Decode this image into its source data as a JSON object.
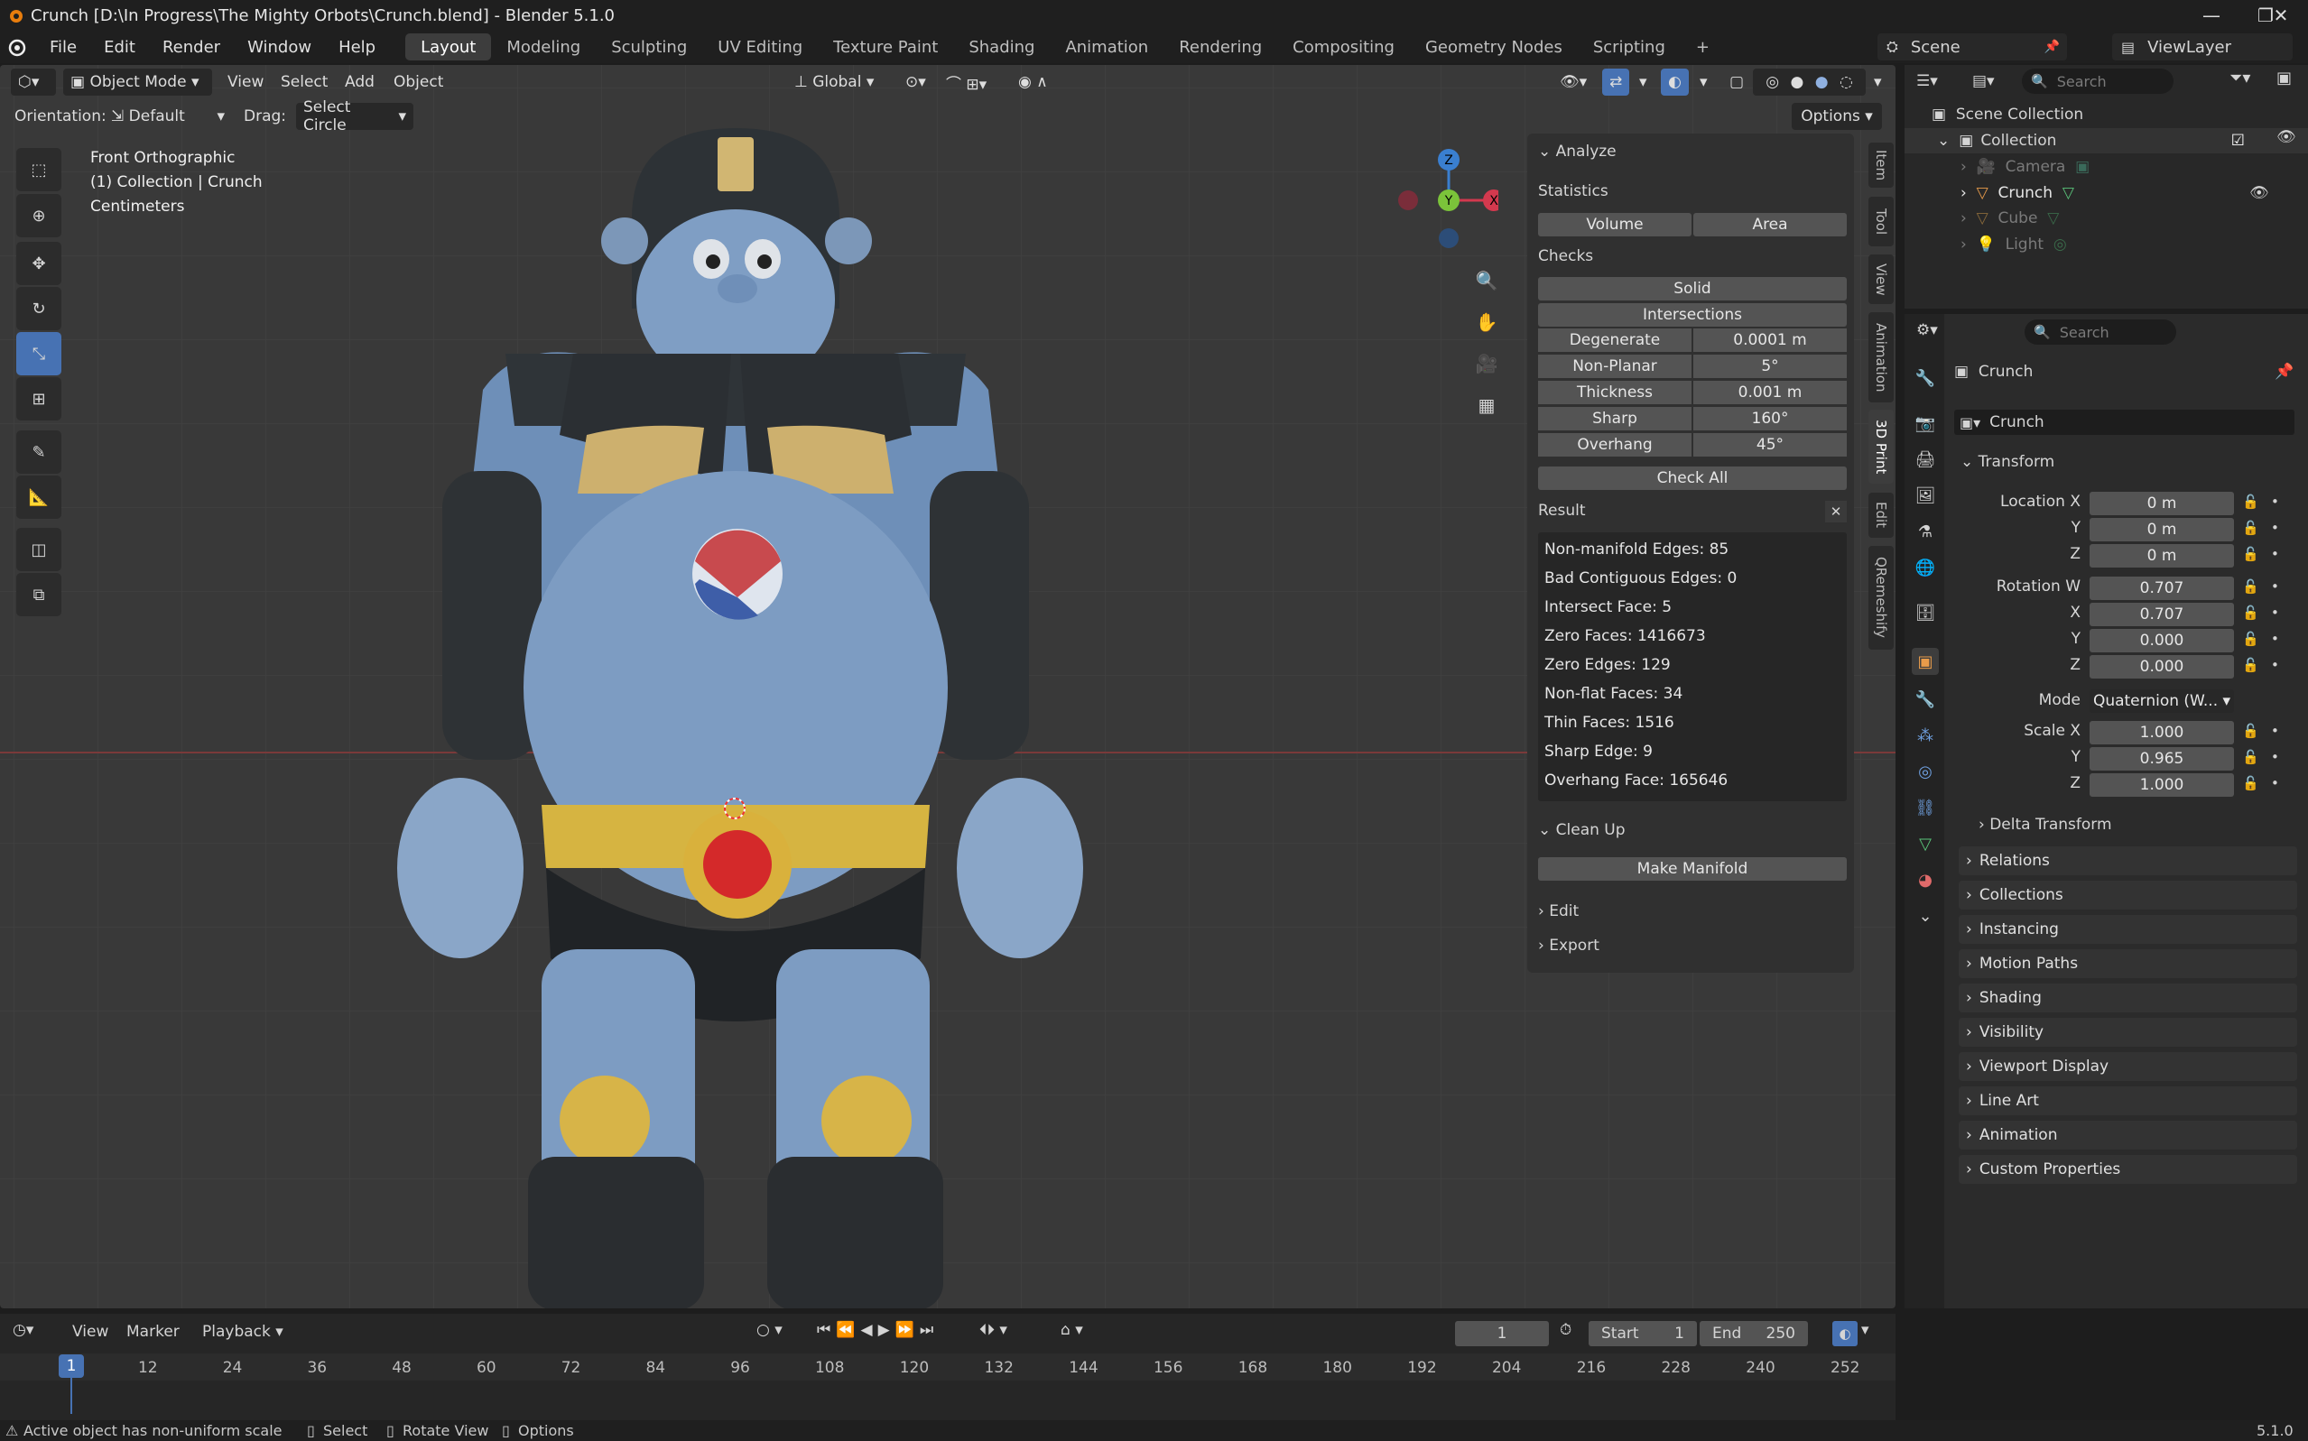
{
  "window": {
    "title": "Crunch [D:\\In Progress\\The Mighty Orbots\\Crunch.blend] - Blender 5.1.0"
  },
  "menus": [
    "File",
    "Edit",
    "Render",
    "Window",
    "Help"
  ],
  "workspaces": [
    "Layout",
    "Modeling",
    "Sculpting",
    "UV Editing",
    "Texture Paint",
    "Shading",
    "Animation",
    "Rendering",
    "Compositing",
    "Geometry Nodes",
    "Scripting"
  ],
  "scene": {
    "label": "Scene",
    "viewlayer": "ViewLayer"
  },
  "viewport_header": {
    "mode": "Object Mode",
    "view": "View",
    "select": "Select",
    "add": "Add",
    "object": "Object",
    "transform": "Global",
    "orientation_label": "Orientation:",
    "orientation_value": "Default",
    "drag_label": "Drag:",
    "drag_value": "Select Circle",
    "options": "Options"
  },
  "viewport_info": {
    "view_name": "Front Orthographic",
    "collection_path": "(1) Collection | Crunch",
    "units": "Centimeters"
  },
  "gizmo": {
    "z": "Z",
    "y": "Y",
    "x": "X"
  },
  "npanel": {
    "analyze": "Analyze",
    "statistics": "Statistics",
    "volume": "Volume",
    "area": "Area",
    "checks": "Checks",
    "solid": "Solid",
    "intersections": "Intersections",
    "checks_rows": [
      {
        "label": "Degenerate",
        "value": "0.0001 m"
      },
      {
        "label": "Non-Planar",
        "value": "5°"
      },
      {
        "label": "Thickness",
        "value": "0.001 m"
      },
      {
        "label": "Sharp",
        "value": "160°"
      },
      {
        "label": "Overhang",
        "value": "45°"
      }
    ],
    "check_all": "Check All",
    "result": "Result",
    "results": [
      "Non-manifold Edges: 85",
      "Bad Contiguous Edges: 0",
      "Intersect Face: 5",
      "Zero Faces: 1416673",
      "Zero Edges: 129",
      "Non-flat Faces: 34",
      "Thin Faces: 1516",
      "Sharp Edge: 9",
      "Overhang Face: 165646"
    ],
    "clean_up": "Clean Up",
    "make_manifold": "Make Manifold",
    "edit": "Edit",
    "export": "Export"
  },
  "side_tabs": [
    "Item",
    "Tool",
    "View",
    "Animation",
    "3D Print",
    "Edit",
    "QRemeshify"
  ],
  "outliner": {
    "search_placeholder": "Search",
    "scene_collection": "Scene Collection",
    "collection": "Collection",
    "items": [
      "Camera",
      "Crunch",
      "Cube",
      "Light"
    ]
  },
  "properties": {
    "search_placeholder": "Search",
    "object_name": "Crunch",
    "data_name": "Crunch",
    "transform": "Transform",
    "location": {
      "label_x": "Location X",
      "label_y": "Y",
      "label_z": "Z",
      "x": "0 m",
      "y": "0 m",
      "z": "0 m"
    },
    "rotation": {
      "label_w": "Rotation W",
      "label_x": "X",
      "label_y": "Y",
      "label_z": "Z",
      "w": "0.707",
      "x": "0.707",
      "y": "0.000",
      "z": "0.000"
    },
    "mode_label": "Mode",
    "mode_value": "Quaternion (W...",
    "scale": {
      "label_x": "Scale X",
      "label_y": "Y",
      "label_z": "Z",
      "x": "1.000",
      "y": "0.965",
      "z": "1.000"
    },
    "delta_transform": "Delta Transform",
    "sections": [
      "Relations",
      "Collections",
      "Instancing",
      "Motion Paths",
      "Shading",
      "Visibility",
      "Viewport Display",
      "Line Art",
      "Animation",
      "Custom Properties"
    ]
  },
  "timeline": {
    "view": "View",
    "marker": "Marker",
    "playback": "Playback",
    "current_frame": "1",
    "start_label": "Start",
    "start": "1",
    "end_label": "End",
    "end": "250",
    "ticks": [
      "12",
      "24",
      "36",
      "48",
      "60",
      "72",
      "84",
      "96",
      "108",
      "120",
      "132",
      "144",
      "156",
      "168",
      "180",
      "192",
      "204",
      "216",
      "228",
      "240",
      "252"
    ],
    "playhead": "1"
  },
  "status": {
    "message": "Active object has non-uniform scale",
    "select": "Select",
    "rotate": "Rotate View",
    "options": "Options",
    "version": "5.1.0"
  }
}
